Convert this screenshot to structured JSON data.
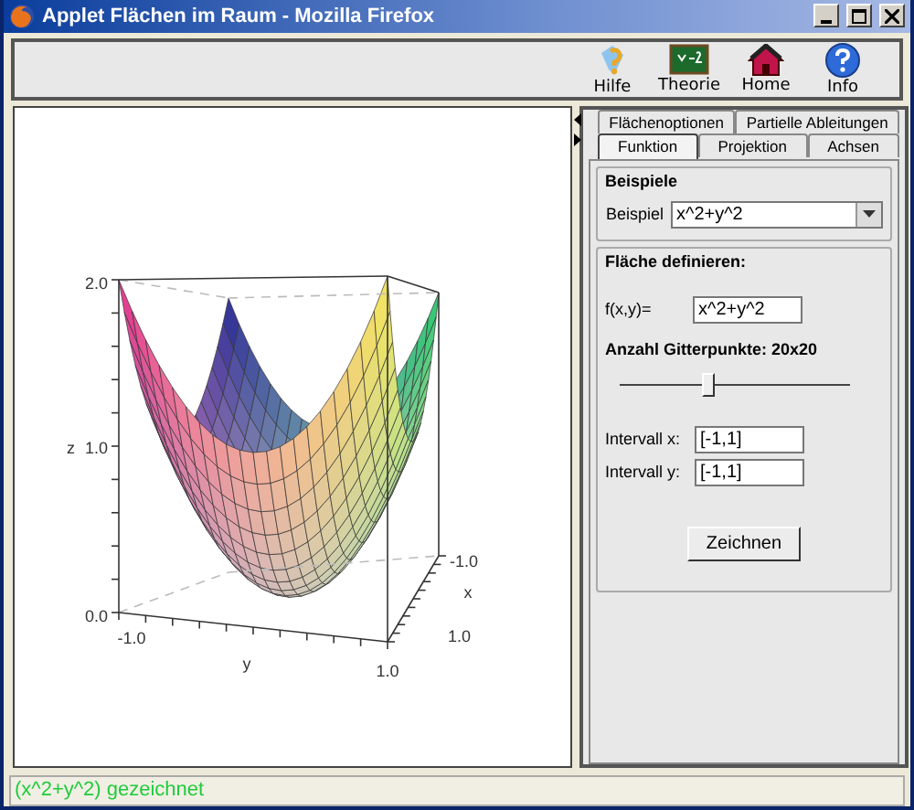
{
  "window": {
    "title": "Applet Flächen im Raum - Mozilla Firefox"
  },
  "toolbar": [
    {
      "label": "Hilfe",
      "kind": "help"
    },
    {
      "label": "Theorie",
      "kind": "theory"
    },
    {
      "label": "Home",
      "kind": "home"
    },
    {
      "label": "Info",
      "kind": "info"
    }
  ],
  "plot": {
    "z_label": "z",
    "z_ticks": [
      "2.0",
      "1.0",
      "0.0"
    ],
    "y_label": "y",
    "y_ticks": [
      "-1.0",
      "1.0"
    ],
    "x_label": "x",
    "x_ticks": [
      "-1.0",
      "1.0"
    ]
  },
  "tab_rows": [
    {
      "tabs": [
        {
          "label": "Flächenoptionen",
          "selected": false
        },
        {
          "label": "Partielle Ableitungen",
          "selected": false
        }
      ]
    },
    {
      "tabs": [
        {
          "label": "Funktion",
          "selected": true
        },
        {
          "label": "Projektion",
          "selected": false
        },
        {
          "label": "Achsen",
          "selected": false
        }
      ]
    }
  ],
  "examples": {
    "title": "Beispiele",
    "label": "Beispiel",
    "value": "x^2+y^2"
  },
  "define": {
    "title": "Fläche definieren:",
    "function_label": "f(x,y)=",
    "function_value": "x^2+y^2",
    "grid_label": "Anzahl Gitterpunkte: 20x20",
    "grid_slider": {
      "level": 0.38
    },
    "intervals": [
      {
        "label": "Intervall x:",
        "value": "[-1,1]"
      },
      {
        "label": "Intervall y:",
        "value": "[-1,1]"
      }
    ],
    "button": "Zeichnen"
  },
  "status_bar": {
    "text": "(x^2+y^2) gezeichnet"
  }
}
